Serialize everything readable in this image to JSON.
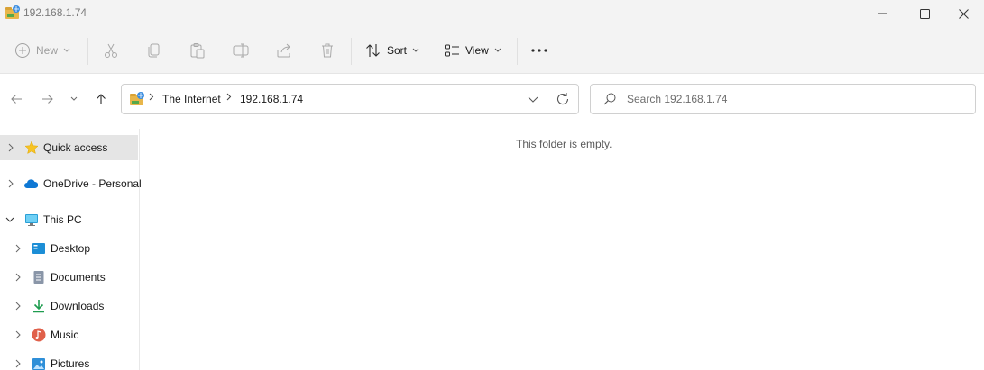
{
  "window": {
    "title": "192.168.1.74",
    "controls": [
      "minimize",
      "maximize",
      "close"
    ]
  },
  "toolbar": {
    "new_label": "New",
    "sort_label": "Sort",
    "view_label": "View",
    "icons": [
      "new-icon",
      "cut-icon",
      "copy-icon",
      "paste-icon",
      "rename-icon",
      "share-icon",
      "delete-icon",
      "sort-icon",
      "view-icon",
      "more-icon"
    ]
  },
  "address": {
    "crumbs": [
      "The Internet",
      "192.168.1.74"
    ]
  },
  "search": {
    "placeholder": "Search 192.168.1.74"
  },
  "sidebar": {
    "items": [
      {
        "label": "Quick access",
        "icon": "star-icon",
        "selected": true,
        "expanded": false
      },
      {
        "label": "OneDrive - Personal",
        "icon": "cloud-icon",
        "selected": false,
        "expanded": false
      },
      {
        "label": "This PC",
        "icon": "computer-icon",
        "selected": false,
        "expanded": true
      },
      {
        "label": "Desktop",
        "icon": "desktop-icon"
      },
      {
        "label": "Documents",
        "icon": "documents-icon"
      },
      {
        "label": "Downloads",
        "icon": "downloads-icon"
      },
      {
        "label": "Music",
        "icon": "music-icon"
      },
      {
        "label": "Pictures",
        "icon": "pictures-icon"
      }
    ]
  },
  "content": {
    "empty_message": "This folder is empty."
  },
  "colors": {
    "chrome_bg": "#f3f3f3",
    "selected_bg": "#e5e5e5",
    "star": "#f7c325",
    "onedrive": "#0f78d4",
    "downloads": "#1e9c4f",
    "music": "#e0604a"
  }
}
